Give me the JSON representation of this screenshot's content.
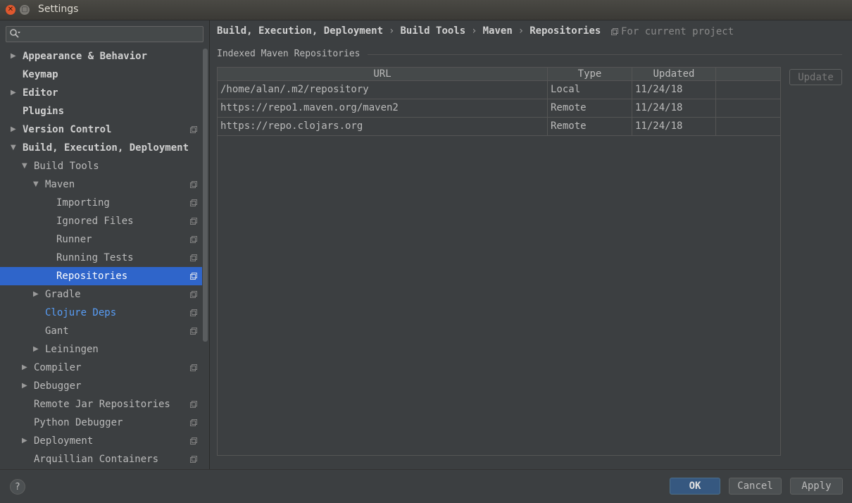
{
  "window": {
    "title": "Settings",
    "close_glyph": "✕",
    "max_glyph": "▢"
  },
  "search": {
    "placeholder": "",
    "value": ""
  },
  "sidebar": {
    "items": [
      {
        "label": "Appearance & Behavior",
        "indent": 0,
        "arrow": "right",
        "bold": true,
        "project": false
      },
      {
        "label": "Keymap",
        "indent": 0,
        "arrow": "none",
        "bold": true,
        "project": false
      },
      {
        "label": "Editor",
        "indent": 0,
        "arrow": "right",
        "bold": true,
        "project": false
      },
      {
        "label": "Plugins",
        "indent": 0,
        "arrow": "none",
        "bold": true,
        "project": false
      },
      {
        "label": "Version Control",
        "indent": 0,
        "arrow": "right",
        "bold": true,
        "project": true
      },
      {
        "label": "Build, Execution, Deployment",
        "indent": 0,
        "arrow": "down",
        "bold": true,
        "project": false
      },
      {
        "label": "Build Tools",
        "indent": 1,
        "arrow": "down",
        "bold": false,
        "project": false
      },
      {
        "label": "Maven",
        "indent": 2,
        "arrow": "down",
        "bold": false,
        "project": true
      },
      {
        "label": "Importing",
        "indent": 3,
        "arrow": "none",
        "bold": false,
        "project": true
      },
      {
        "label": "Ignored Files",
        "indent": 3,
        "arrow": "none",
        "bold": false,
        "project": true
      },
      {
        "label": "Runner",
        "indent": 3,
        "arrow": "none",
        "bold": false,
        "project": true
      },
      {
        "label": "Running Tests",
        "indent": 3,
        "arrow": "none",
        "bold": false,
        "project": true
      },
      {
        "label": "Repositories",
        "indent": 3,
        "arrow": "none",
        "bold": false,
        "project": true,
        "selected": true
      },
      {
        "label": "Gradle",
        "indent": 2,
        "arrow": "right",
        "bold": false,
        "project": true
      },
      {
        "label": "Clojure Deps",
        "indent": 2,
        "arrow": "none",
        "bold": false,
        "project": true,
        "link": true
      },
      {
        "label": "Gant",
        "indent": 2,
        "arrow": "none",
        "bold": false,
        "project": true
      },
      {
        "label": "Leiningen",
        "indent": 2,
        "arrow": "right",
        "bold": false,
        "project": false
      },
      {
        "label": "Compiler",
        "indent": 1,
        "arrow": "right",
        "bold": false,
        "project": true
      },
      {
        "label": "Debugger",
        "indent": 1,
        "arrow": "right",
        "bold": false,
        "project": false
      },
      {
        "label": "Remote Jar Repositories",
        "indent": 1,
        "arrow": "none",
        "bold": false,
        "project": true
      },
      {
        "label": "Python Debugger",
        "indent": 1,
        "arrow": "none",
        "bold": false,
        "project": true
      },
      {
        "label": "Deployment",
        "indent": 1,
        "arrow": "right",
        "bold": false,
        "project": true
      },
      {
        "label": "Arquillian Containers",
        "indent": 1,
        "arrow": "none",
        "bold": false,
        "project": true
      }
    ]
  },
  "breadcrumb": {
    "items": [
      "Build, Execution, Deployment",
      "Build Tools",
      "Maven",
      "Repositories"
    ],
    "separator": "›",
    "scope_label": "For current project"
  },
  "section": {
    "title": "Indexed Maven Repositories"
  },
  "table": {
    "columns": [
      "URL",
      "Type",
      "Updated",
      ""
    ],
    "rows": [
      [
        "/home/alan/.m2/repository",
        "Local",
        "11/24/18",
        ""
      ],
      [
        "https://repo1.maven.org/maven2",
        "Remote",
        "11/24/18",
        ""
      ],
      [
        "https://repo.clojars.org",
        "Remote",
        "11/24/18",
        ""
      ]
    ]
  },
  "buttons": {
    "update": "Update",
    "help": "?",
    "ok": "OK",
    "cancel": "Cancel",
    "apply": "Apply"
  },
  "colors": {
    "background": "#3c3f41",
    "selection": "#2f65ca",
    "link": "#589df6",
    "primary_button": "#365880"
  },
  "icons": {
    "tree_arrow_right": "▶",
    "tree_arrow_down": "▼",
    "project_scope": "project-scope-icon",
    "search": "search-icon"
  }
}
